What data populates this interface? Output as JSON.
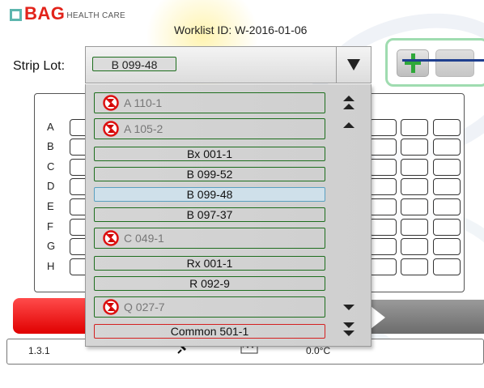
{
  "header": {
    "logo_brand": "BAG",
    "logo_sub": "HEALTH CARE",
    "worklist_label": "Worklist ID: W-2016-01-06"
  },
  "strip_lot": {
    "label": "Strip Lot:",
    "selected": "B 099-48"
  },
  "dropdown": {
    "items": [
      {
        "label": "A 110-1",
        "status": "expired"
      },
      {
        "label": "A 105-2",
        "status": "expired"
      },
      {
        "label": "Bx 001-1",
        "status": "normal"
      },
      {
        "label": "B 099-52",
        "status": "normal"
      },
      {
        "label": "B 099-48",
        "status": "selected"
      },
      {
        "label": "B 097-37",
        "status": "normal"
      },
      {
        "label": "C 049-1",
        "status": "expired"
      },
      {
        "label": "Rx 001-1",
        "status": "normal"
      },
      {
        "label": "R 092-9",
        "status": "normal"
      },
      {
        "label": "Q 027-7",
        "status": "expired"
      },
      {
        "label": "Common 501-1",
        "status": "error"
      }
    ]
  },
  "grid": {
    "rows": [
      "A",
      "B",
      "C",
      "D",
      "E",
      "F",
      "G",
      "H"
    ]
  },
  "status_bar": {
    "version": "1.3.1",
    "temperature": "0.0°C"
  },
  "colors": {
    "accent_green": "#1e6e1e",
    "brand_red": "#e2231a",
    "logo_teal": "#5db6ae",
    "selected_row": "#cfe0ea",
    "error_border": "#d42020"
  }
}
